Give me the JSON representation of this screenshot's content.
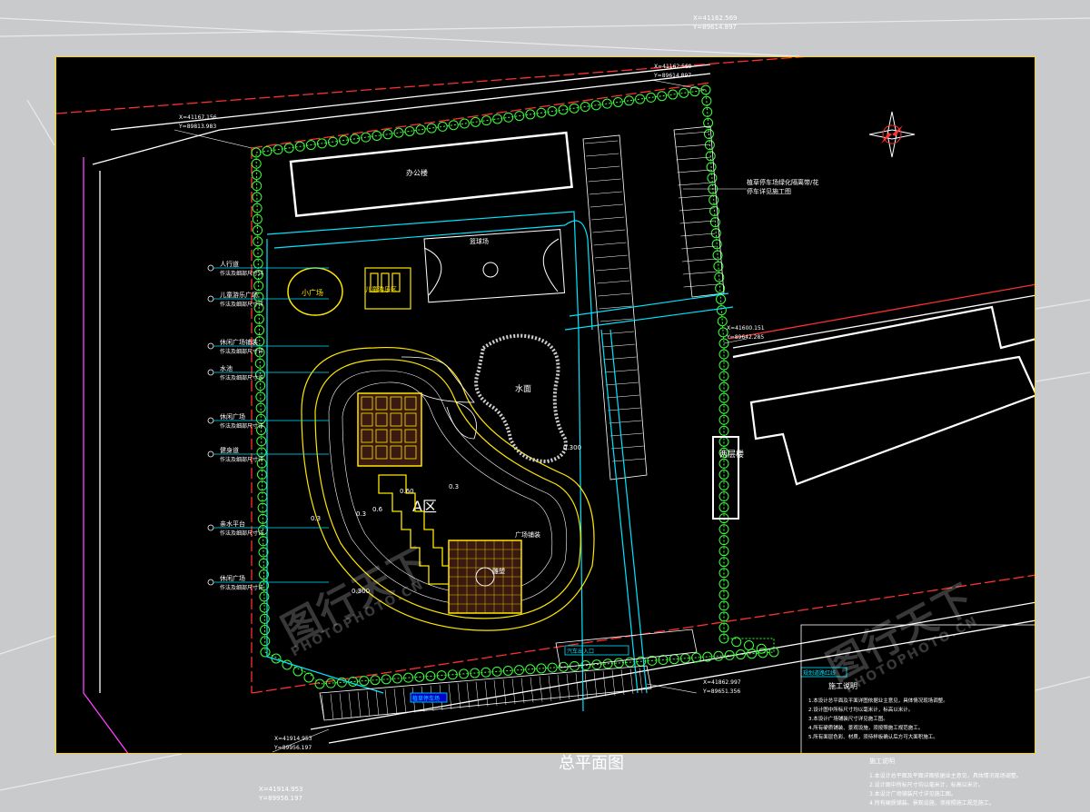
{
  "outer": {
    "coord_top_right_1": "X=41162.569",
    "coord_top_right_2": "Y=89614.897",
    "coord_bottom_left_1": "X=41914.953",
    "coord_bottom_left_2": "Y=89956.197",
    "bottom_title": "总平面图",
    "notes_title": "施工说明",
    "notes_lines": [
      "1.本设计总平面及平面详图依据业主意见，具体情况现场调整。",
      "2.设计图中所标尺寸均以毫米计，标高以米计。",
      "3.本设计广场铺装尺寸详见施工图。",
      "4.所有硬质铺装、景观设施，须按照施工规范施工。",
      "5.所有面层色彩、材质，须待样板确认后方可大面积施工。"
    ]
  },
  "plan": {
    "coord_top_1": "X=41162.569",
    "coord_top_2": "Y=89614.897",
    "coord_topleft_1": "X=41167.156",
    "coord_topleft_2": "Y=89813.983",
    "coord_right_1": "X=41600.151",
    "coord_right_2": "Y=89642.285",
    "coord_bottom_right_1": "X=41862.997",
    "coord_bottom_right_2": "Y=89651.356",
    "coord_bottom_left_1": "X=41914.953",
    "coord_bottom_left_2": "Y=89956.197",
    "building_top_label": "办公楼",
    "building_right_label": "两层楼",
    "court_label": "篮球场",
    "small_plaza_label": "小广场",
    "children_area_label": "儿童游乐区",
    "pond_label": "水面",
    "zone_label": "A区",
    "center_label": "雕塑",
    "square_label": "广场铺装",
    "parking_note_1": "植草停车场绿化隔离带/花",
    "parking_note_2": "停车详见施工图",
    "left_labels": [
      {
        "title": "人行道",
        "sub": "作法及细部尺寸详"
      },
      {
        "title": "儿童游乐广场",
        "sub": "作法及细部尺寸详"
      },
      {
        "title": "休闲广场铺装",
        "sub": "作法及细部尺寸详"
      },
      {
        "title": "水池",
        "sub": "作法及细部尺寸详"
      },
      {
        "title": "休闲广场",
        "sub": "作法及细部尺寸详"
      },
      {
        "title": "健身道",
        "sub": "作法及细部尺寸详"
      },
      {
        "title": "亲水平台",
        "sub": "作法及细部尺寸详"
      },
      {
        "title": "休闲广场",
        "sub": "作法及细部尺寸详"
      }
    ],
    "bottom_parking_label": "植草停车场",
    "bottom_right_label": "汽车出入口",
    "road_label": "规划道路红线",
    "levels": [
      "0.3",
      "0.60",
      "0.3",
      "0.6",
      "0.3",
      "0.300",
      "0.300"
    ]
  },
  "watermark": {
    "text_cn": "图行天下",
    "text_en": "PHOTOPHOTO.CN"
  },
  "colors": {
    "cad_cyan": "#00e5ff",
    "cad_green": "#3cff3c",
    "cad_yellow": "#ffe600",
    "cad_red": "#ff3030",
    "cad_white": "#ffffff",
    "cad_magenta": "#ff40ff",
    "frame": "#ffd800"
  }
}
